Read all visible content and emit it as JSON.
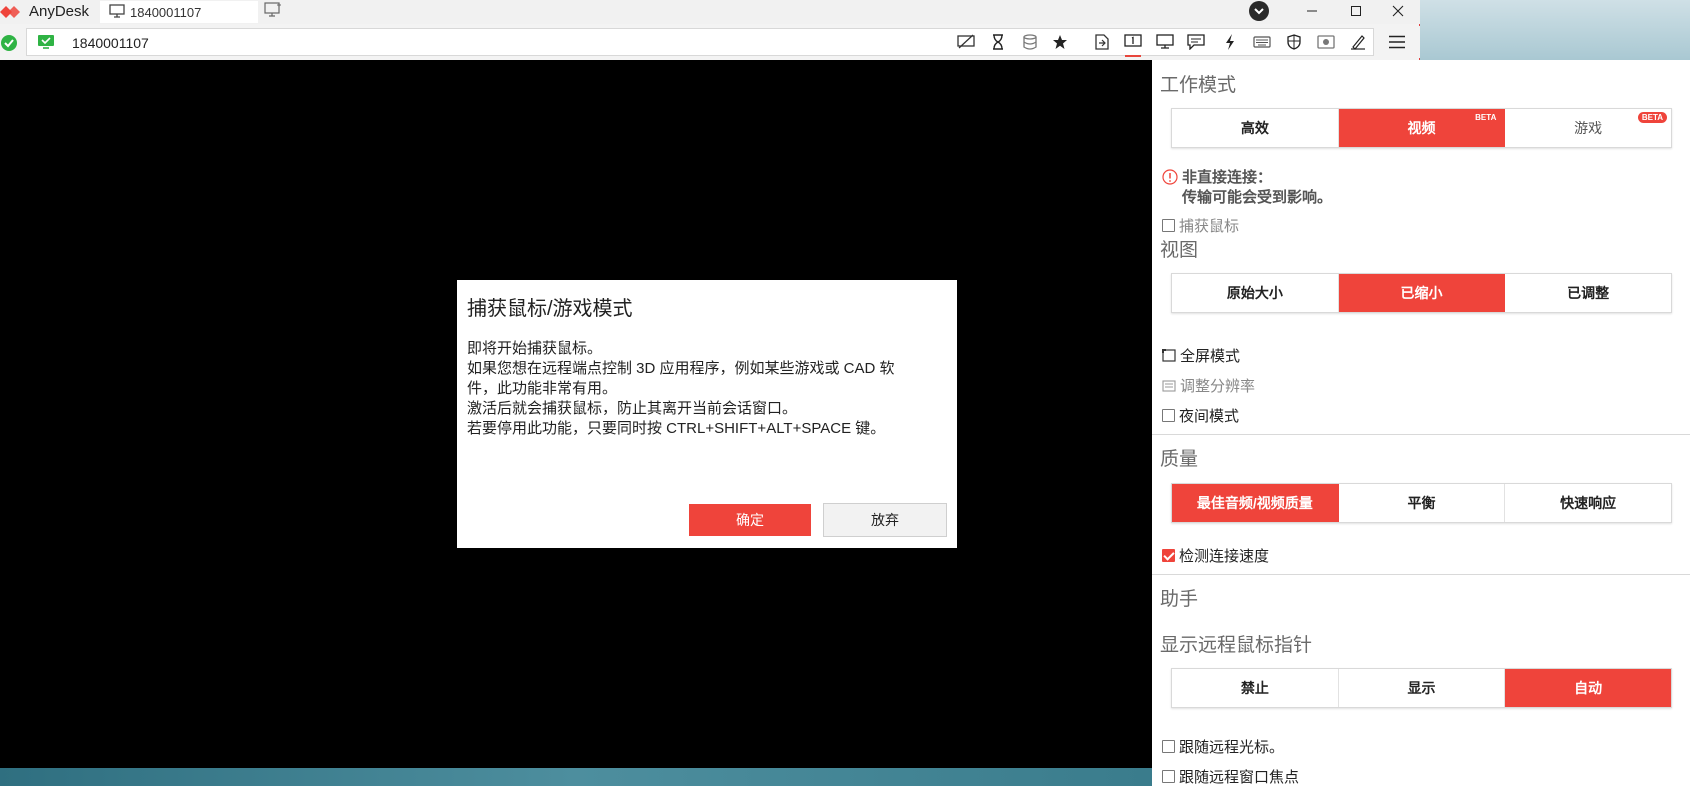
{
  "app": {
    "name": "AnyDesk",
    "tab_title": "1840001107",
    "address": "1840001107"
  },
  "dialog": {
    "title": "捕获鼠标/游戏模式",
    "lines": [
      "即将开始捕获鼠标。",
      "如果您想在远程端点控制 3D 应用程序，例如某些游戏或 CAD 软",
      "件，此功能非常有用。",
      "激活后就会捕获鼠标，防止其离开当前会话窗口。",
      "若要停用此功能，只要同时按 CTRL+SHIFT+ALT+SPACE 键。"
    ],
    "ok_label": "确定",
    "cancel_label": "放弃"
  },
  "panel": {
    "work_mode": {
      "heading": "工作模式",
      "options": [
        "高效",
        "视频",
        "游戏"
      ],
      "selected": "视频",
      "beta_label": "BETA"
    },
    "warning": {
      "line1": "非直接连接：",
      "line2": "传输可能会受到影响。"
    },
    "capture_mouse_label": "捕获鼠标",
    "view": {
      "heading": "视图",
      "options": [
        "原始大小",
        "已缩小",
        "已调整"
      ],
      "selected": "已缩小",
      "fullscreen_label": "全屏模式",
      "resolution_label": "调整分辨率",
      "night_mode_label": "夜间模式"
    },
    "quality": {
      "heading": "质量",
      "options": [
        "最佳音频/视频质量",
        "平衡",
        "快速响应"
      ],
      "selected": "最佳音频/视频质量",
      "detect_speed_label": "检测连接速度"
    },
    "assistant": {
      "heading": "助手"
    },
    "remote_cursor": {
      "heading": "显示远程鼠标指针",
      "options": [
        "禁止",
        "显示",
        "自动"
      ],
      "selected": "自动",
      "follow_cursor_label": "跟随远程光标。",
      "follow_focus_label": "跟随远程窗口焦点"
    }
  },
  "toolbar_icons": [
    "privacy-icon",
    "hourglass-icon",
    "database-icon",
    "star-icon",
    "file-transfer-icon",
    "monitor-1-icon",
    "display-icon",
    "chat-icon",
    "lightning-icon",
    "keyboard-icon",
    "permissions-icon",
    "record-icon",
    "whiteboard-icon",
    "menu-icon"
  ],
  "colors": {
    "accent": "#ef443b",
    "status_ok": "#2fb344"
  }
}
